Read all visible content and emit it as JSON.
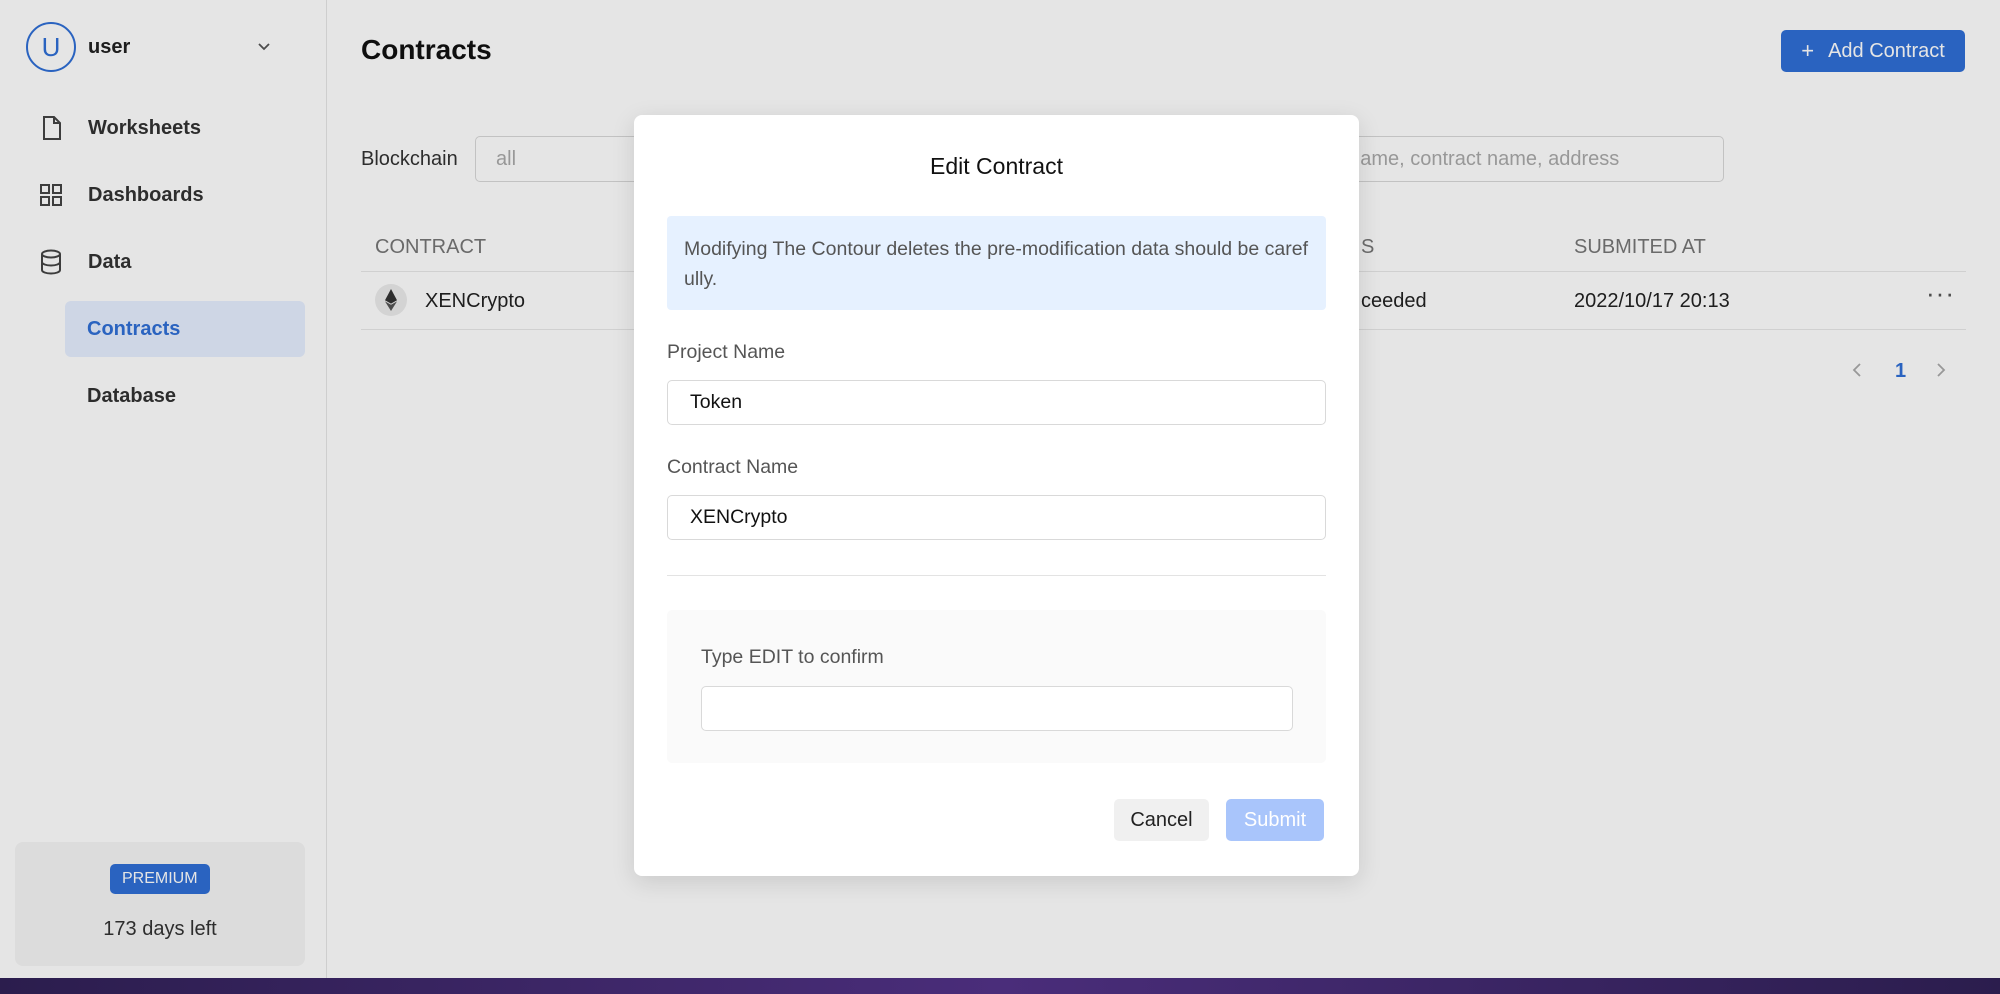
{
  "sidebar": {
    "user": {
      "avatar_letter": "U",
      "name": "user"
    },
    "nav": [
      {
        "label": "Worksheets",
        "icon": "file-icon"
      },
      {
        "label": "Dashboards",
        "icon": "grid-icon"
      },
      {
        "label": "Data",
        "icon": "database-icon"
      }
    ],
    "sub_nav": [
      {
        "label": "Contracts",
        "active": true
      },
      {
        "label": "Database",
        "active": false
      }
    ],
    "plan": {
      "badge": "PREMIUM",
      "days_left": "173 days left"
    }
  },
  "main": {
    "title": "Contracts",
    "add_button": {
      "icon": "plus-icon",
      "label": "Add Contract"
    },
    "filters": {
      "blockchain_label": "Blockchain",
      "blockchain_value": "all",
      "search_placeholder": "t name, contract name, address"
    },
    "table": {
      "columns": [
        "CONTRACT",
        "S",
        "SUBMITED AT"
      ],
      "rows": [
        {
          "contract": "XENCrypto",
          "icon": "ethereum-icon",
          "status": "ceeded",
          "submitted_at": "2022/10/17 20:13",
          "actions": "···"
        }
      ]
    },
    "pagination": {
      "current_page": "1"
    }
  },
  "modal": {
    "title": "Edit Contract",
    "alert": "Modifying The Contour deletes the pre-modification data should be carefully.",
    "project_name_label": "Project Name",
    "project_name_value": "Token",
    "contract_name_label": "Contract Name",
    "contract_name_value": "XENCrypto",
    "confirm_label": "Type EDIT to confirm",
    "confirm_value": "",
    "cancel_label": "Cancel",
    "submit_label": "Submit"
  },
  "colors": {
    "accent": "#2f6fd6",
    "submit_disabled": "#a9c5fb",
    "alert_bg": "#e6f1ff"
  }
}
